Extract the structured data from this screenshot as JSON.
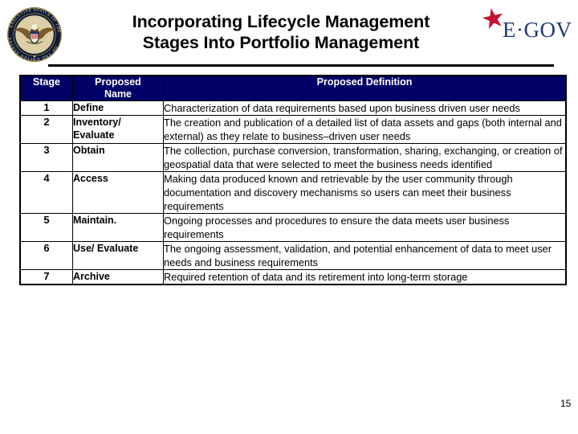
{
  "header": {
    "title_line1": "Incorporating Lifecycle Management",
    "title_line2": "Stages Into Portfolio Management",
    "seal_name": "executive-office-of-the-president-seal",
    "seal_ring_text_top": "EXECUTIVE OFFICE OF THE PRESIDENT",
    "seal_ring_text_bottom": "OF THE UNITED STATES",
    "egov_text": "E·GOV",
    "egov_star": "red-star-icon"
  },
  "colors": {
    "header_navy": "#000066",
    "egov_navy": "#1f3a70",
    "egov_star_red": "#c41230",
    "rule_black": "#000000",
    "page_bg": "#ffffff"
  },
  "table": {
    "columns": [
      "Stage",
      "Proposed Name",
      "Proposed Definition"
    ],
    "column_header_lines": [
      [
        "Stage"
      ],
      [
        "Proposed",
        "Name"
      ],
      [
        "Proposed Definition"
      ]
    ],
    "rows": [
      {
        "stage": "1",
        "name": "Define",
        "definition": "Characterization of data requirements based upon business driven user needs"
      },
      {
        "stage": "2",
        "name": "Inventory/ Evaluate",
        "definition": "The creation and publication of a detailed list of data assets and gaps (both internal and external) as they relate to business–driven user needs"
      },
      {
        "stage": "3",
        "name": "Obtain",
        "definition": "The collection, purchase conversion, transformation, sharing, exchanging, or creation of geospatial data that were selected to meet the business needs identified"
      },
      {
        "stage": "4",
        "name": "Access",
        "definition": "Making data produced known and retrievable by the user community through documentation and discovery mechanisms so users can meet their business requirements"
      },
      {
        "stage": "5",
        "name": "Maintain.",
        "definition": "Ongoing processes and procedures to ensure the data meets user business requirements"
      },
      {
        "stage": "6",
        "name": "Use/ Evaluate",
        "definition": "The ongoing assessment, validation, and potential enhancement of data to meet user needs and business requirements"
      },
      {
        "stage": "7",
        "name": "Archive",
        "definition": "Required retention of data and its retirement into long-term storage"
      }
    ]
  },
  "footer": {
    "page_number": "15"
  }
}
